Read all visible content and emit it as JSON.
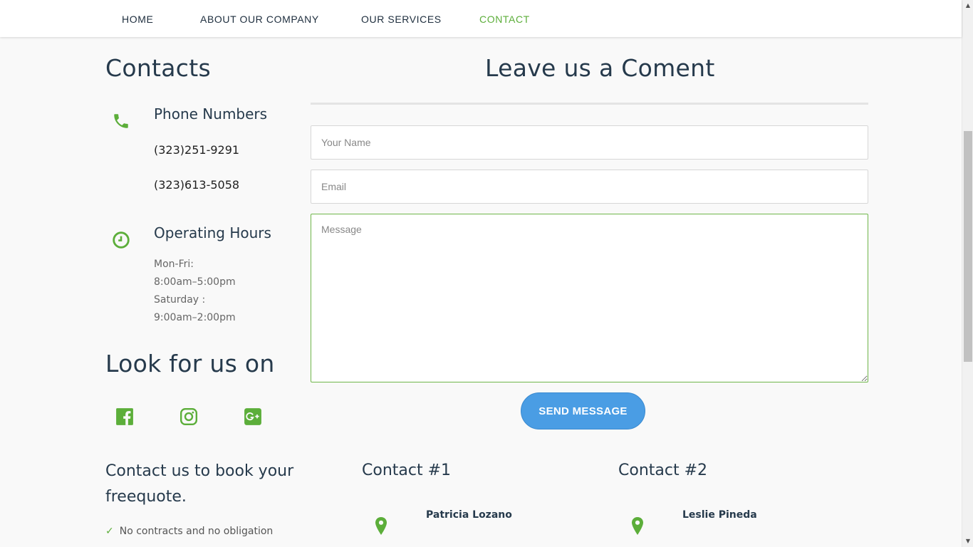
{
  "nav": {
    "items": [
      {
        "label": "HOME"
      },
      {
        "label": "ABOUT OUR COMPANY"
      },
      {
        "label": "OUR SERVICES"
      },
      {
        "label": "CONTACT"
      }
    ],
    "active": "CONTACT"
  },
  "contacts": {
    "title": "Contacts",
    "phone_heading": "Phone Numbers",
    "phones": [
      "(323)251-9291",
      "(323)613-5058"
    ],
    "hours_heading": "Operating Hours",
    "hours": [
      "Mon-Fri:",
      "8:00am–5:00pm",
      "Saturday :",
      "9:00am–2:00pm"
    ]
  },
  "social": {
    "title": "Look for us on",
    "icons": [
      "facebook-icon",
      "instagram-icon",
      "google-plus-icon"
    ]
  },
  "form": {
    "title": "Leave us a Coment",
    "name_placeholder": "Your Name",
    "email_placeholder": "Email",
    "message_placeholder": "Message",
    "name_value": "",
    "email_value": "",
    "message_value": "",
    "send_label": "SEND MESSAGE"
  },
  "bottom": {
    "book_heading": "Contact us to book your freequote.",
    "check_item": "No contracts and no obligation",
    "contacts": [
      {
        "heading": "Contact #1",
        "name": "Patricia Lozano"
      },
      {
        "heading": "Contact #2",
        "name": "Leslie Pineda"
      }
    ]
  },
  "colors": {
    "accent_green": "#5cae3a",
    "button_blue": "#4a9de4",
    "heading_dark": "#263a4c"
  }
}
